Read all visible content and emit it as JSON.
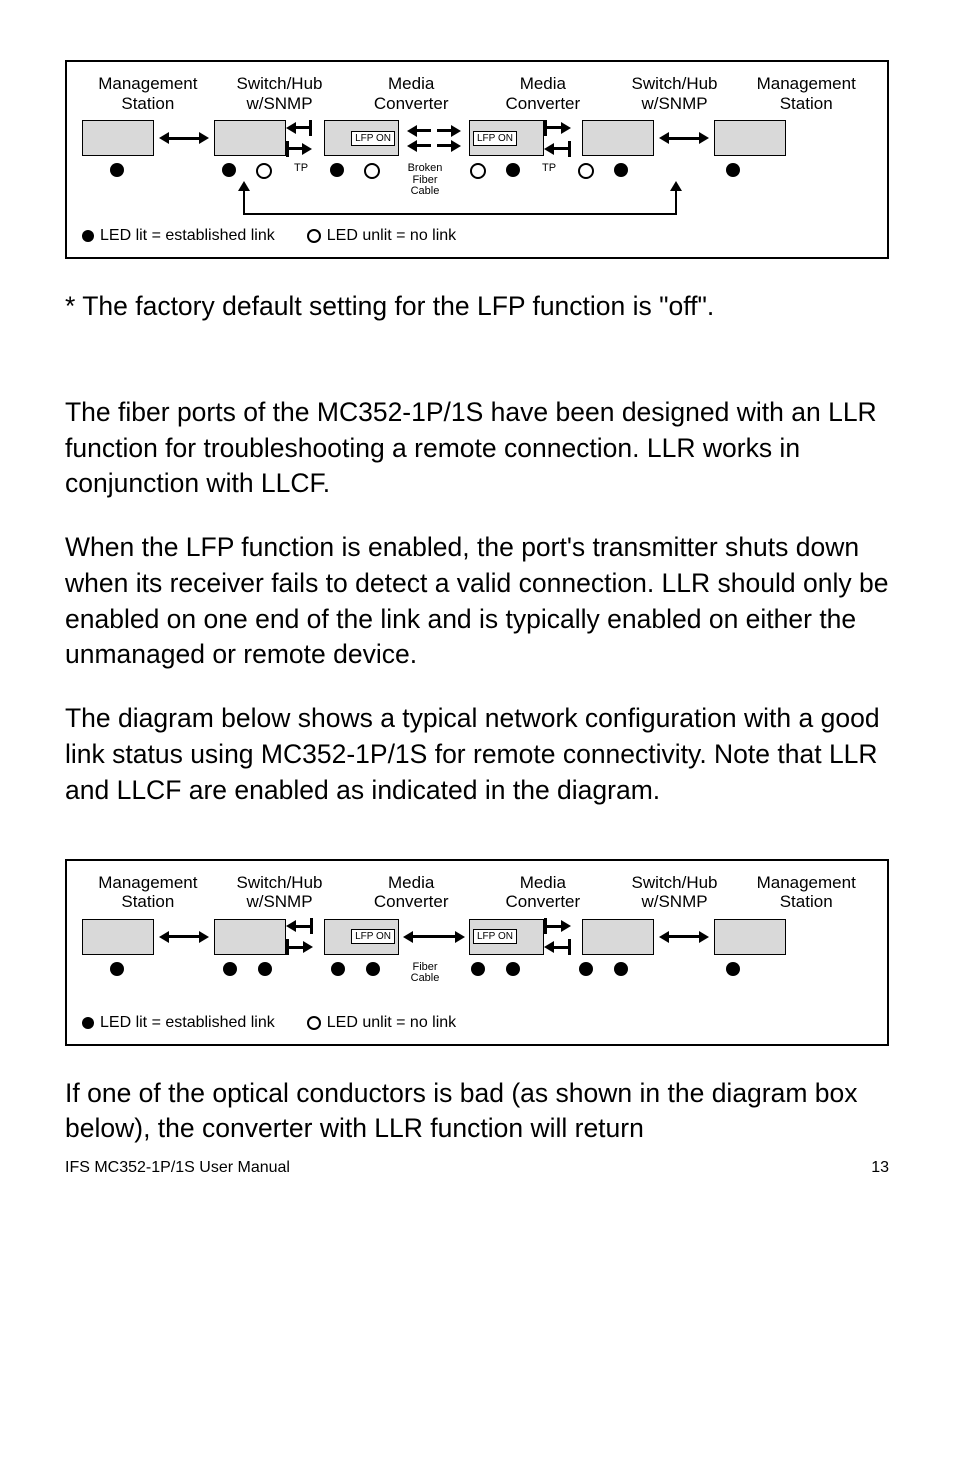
{
  "diagram1": {
    "col1": "Management\nStation",
    "col2": "Switch/Hub\nw/SNMP",
    "col3": "Media\nConverter",
    "col4": "Media\nConverter",
    "col5": "Switch/Hub\nw/SNMP",
    "col6": "Management\nStation",
    "lfp": "LFP ON",
    "tp": "TP",
    "broken": "Broken\nFiber\nCable",
    "legend_lit": "LED lit = established link",
    "legend_unlit": "LED unlit = no link"
  },
  "para1": "* The factory default setting for the LFP function is \"off\".",
  "para2": "The fiber ports of the MC352-1P/1S have been designed with an LLR function for troubleshooting a remote connection. LLR works in conjunction with LLCF.",
  "para3": "When the LFP function is enabled, the port's transmitter shuts down when its receiver fails to detect a valid connection. LLR should only be enabled on one end of the link and is typically enabled on either the unmanaged or remote device.",
  "para4": "The diagram below shows a typical network configuration with a good link status using MC352-1P/1S for remote connectivity. Note that LLR and LLCF are enabled as indicated in the diagram.",
  "diagram2": {
    "fiber": "Fiber\nCable"
  },
  "para5": "If one of the optical conductors is bad (as shown in the diagram box below), the converter with LLR function will return",
  "footer_left": "IFS MC352-1P/1S User Manual",
  "footer_right": "13"
}
